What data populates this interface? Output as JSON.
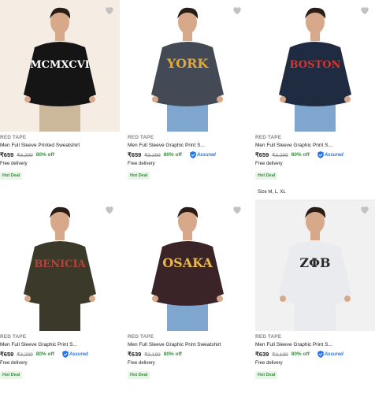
{
  "colors": {
    "green": "#388e3c",
    "blue": "#2874f0",
    "heart": "#c2c2c2"
  },
  "products": [
    {
      "brand": "RED TAPE",
      "title": "Men Full Sleeve Printed Sweatshirt",
      "price": "₹659",
      "mrp": "₹3,299",
      "discount": "80% off",
      "assured": false,
      "delivery": "Free delivery",
      "badge": "Hot Deal",
      "size": "",
      "print": "MCMXCVI",
      "shirt_color": "#151515",
      "text_color": "#ffffff",
      "bg": "beige",
      "pants_color": "#cbb79a"
    },
    {
      "brand": "RED TAPE",
      "title": "Men Full Sleeve Graphic Print S...",
      "price": "₹659",
      "mrp": "₹3,299",
      "discount": "80% off",
      "assured": true,
      "assured_label": "Assured",
      "delivery": "Free delivery",
      "badge": "Hot Deal",
      "size": "",
      "print": "YORK",
      "shirt_color": "#444a55",
      "text_color": "#e0a93a",
      "bg": "white",
      "pants_color": "#7fa6cf"
    },
    {
      "brand": "RED TAPE",
      "title": "Men Full Sleeve Graphic Print S...",
      "price": "₹659",
      "mrp": "₹3,299",
      "discount": "80% off",
      "assured": true,
      "assured_label": "Assured",
      "delivery": "Free delivery",
      "badge": "Hot Deal",
      "size": "",
      "print": "BOSTON",
      "shirt_color": "#1f2b40",
      "text_color": "#d9342b",
      "bg": "white",
      "pants_color": "#7fa6cf"
    },
    {
      "brand": "RED TAPE",
      "title": "Men Full Sleeve Graphic Print S...",
      "price": "₹659",
      "mrp": "₹3,299",
      "discount": "80% off",
      "assured": true,
      "assured_label": "Assured",
      "delivery": "Free delivery",
      "badge": "Hot Deal",
      "size": "",
      "print": "BENICIA",
      "shirt_color": "#3b3a2a",
      "text_color": "#b3443a",
      "bg": "white",
      "pants_color": "#3b3a2a"
    },
    {
      "brand": "RED TAPE",
      "title": "Men Full Sleeve Graphic Print Sweatshirt",
      "price": "₹639",
      "mrp": "₹3,199",
      "discount": "80% off",
      "assured": false,
      "delivery": "Free delivery",
      "badge": "Hot Deal",
      "size": "",
      "print": "OSAKA",
      "shirt_color": "#3a2428",
      "text_color": "#e8b94a",
      "bg": "white",
      "pants_color": "#7fa6cf"
    },
    {
      "brand": "RED TAPE",
      "title": "Men Full Sleeve Graphic Print S...",
      "price": "₹639",
      "mrp": "₹3,199",
      "discount": "80% off",
      "assured": true,
      "assured_label": "Assured",
      "delivery": "Free delivery",
      "badge": "Hot Deal",
      "size": "Size M, L, XL",
      "print": "ZΦB",
      "shirt_color": "#e9ebef",
      "text_color": "#2a2a2a",
      "bg": "grey",
      "pants_color": "#e9ebef"
    }
  ]
}
